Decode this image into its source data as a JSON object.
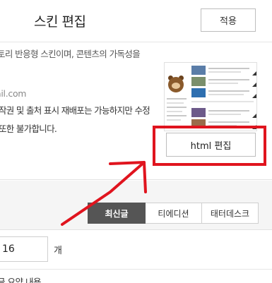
{
  "header": {
    "title": "스킨 편집",
    "apply_label": "적용"
  },
  "skin_info": {
    "description": "토리 반응형 스킨이며, 콘텐츠의 가독성을",
    "email": "ail.com",
    "notice_line1": "작권 및 출처 표시 재배포는 가능하지만 수정",
    "notice_line2": "또한 불가합니다."
  },
  "html_edit_label": "html 편집",
  "tabs": [
    {
      "label": "최신글",
      "active": true
    },
    {
      "label": "티에디션",
      "active": false
    },
    {
      "label": "태터데스크",
      "active": false
    }
  ],
  "post_count": {
    "value": "16",
    "unit": "개"
  },
  "cut_text": "글 요약 내용 ..."
}
